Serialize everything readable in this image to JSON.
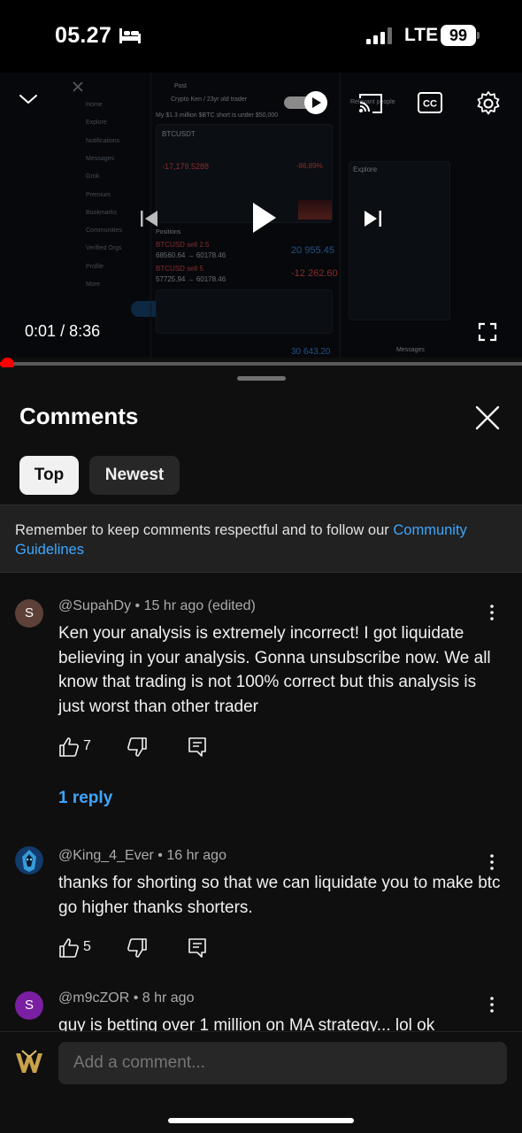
{
  "status_bar": {
    "time": "05.27",
    "network": "LTE",
    "battery": "99"
  },
  "video": {
    "current_time": "0:01",
    "separator": "/",
    "duration": "8:36",
    "progress_fraction": 0.002,
    "screen": {
      "nav_items": [
        "Home",
        "Explore",
        "Notifications",
        "Messages",
        "Grok",
        "Premium",
        "Bookmarks",
        "Communities",
        "Verified Orgs",
        "Profile",
        "More"
      ],
      "post_button": "Post",
      "post_header": "Post",
      "author": "Crypto Ken / 23yr old trader",
      "tweet": "My $1.3 million $BTC short is under $50,000",
      "pair": "BTCUSDT",
      "pnl": "-17,179.5288",
      "roe": "-86.89%",
      "positions_label": "Positions",
      "pos1_name": "BTCUSD sell 2.5",
      "pos1_prices": "68560.64 → 60178.46",
      "pos1_value": "20 955.45",
      "pos2_name": "BTCUSD sell 5",
      "pos2_prices": "57725.94 → 60178.46",
      "pos2_value": "-12 262.60",
      "bottom_value": "30 643.20",
      "relevant_people": "Relevant people",
      "explore": "Explore",
      "messages": "Messages"
    },
    "icons": [
      "chevron-down-icon",
      "autoplay-toggle-icon",
      "cast-icon",
      "cc-icon",
      "settings-icon",
      "previous-icon",
      "play-icon",
      "next-icon",
      "fullscreen-icon"
    ]
  },
  "comments_sheet": {
    "title": "Comments",
    "filters": [
      "Top",
      "Newest"
    ],
    "notice_text": "Remember to keep comments respectful and to follow our ",
    "notice_link": "Community Guidelines",
    "comments": [
      {
        "avatar_letter": "S",
        "avatar_color": "#5d4037",
        "author": "@SupahDy",
        "time": "15 hr ago",
        "edited": "(edited)",
        "text": "Ken your analysis is extremely incorrect! I got liquidate believing in your analysis. Gonna unsubscribe now. We all know that trading is not 100% correct but this analysis is just worst than other trader",
        "likes": "7",
        "replies_label": "1 reply"
      },
      {
        "avatar_letter": "",
        "avatar_color": "#123a6b",
        "author": "@King_4_Ever",
        "time": "16 hr ago",
        "text": "thanks for shorting so that we can liquidate you to make btc go higher thanks shorters.",
        "likes": "5"
      },
      {
        "avatar_letter": "S",
        "avatar_color": "#7b1fa2",
        "author": "@m9cZOR",
        "time": "8 hr ago",
        "text": "guy is betting over 1 million on MA strategy... lol ok"
      }
    ],
    "add_comment_placeholder": "Add a comment..."
  },
  "colors": {
    "background": "#0f0f0f",
    "accent_link": "#3ea6ff",
    "progress": "#ff0000",
    "chip_active": "#f1f1f1",
    "chip_inactive": "#272727"
  }
}
